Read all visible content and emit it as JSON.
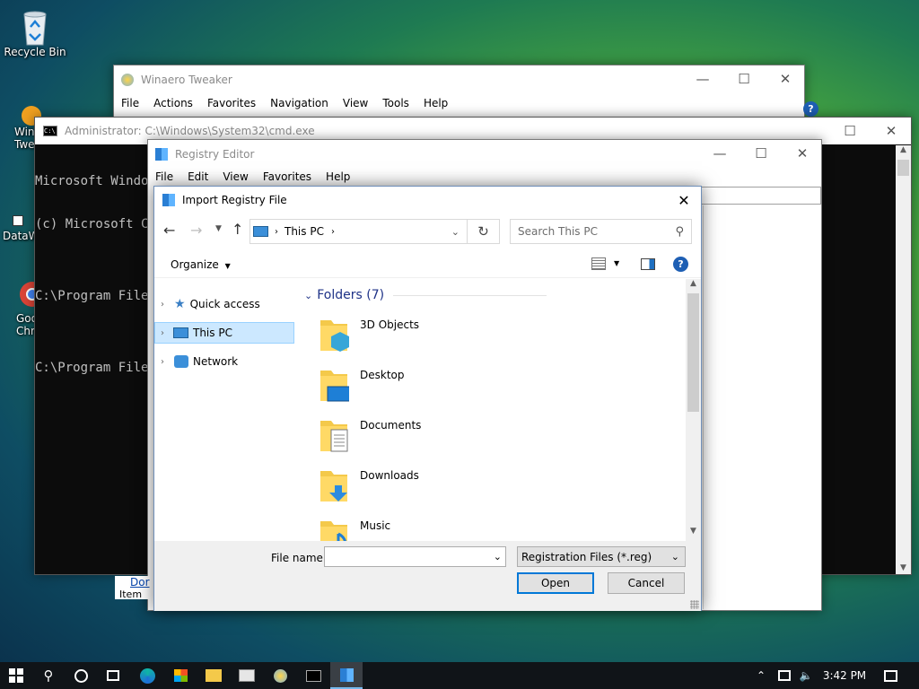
{
  "desktop": {
    "icons": [
      {
        "label": "Recycle Bin"
      },
      {
        "label": "Win\nTwe"
      },
      {
        "label": "DataW"
      },
      {
        "label": "Goo\nChro"
      }
    ]
  },
  "winaero": {
    "title": "Winaero Tweaker",
    "menu": [
      "File",
      "Actions",
      "Favorites",
      "Navigation",
      "View",
      "Tools",
      "Help"
    ]
  },
  "cmd": {
    "title": "Administrator: C:\\Windows\\System32\\cmd.exe",
    "lines": [
      "Microsoft Window",
      "(c) Microsoft Co",
      "",
      "C:\\Program Files",
      "",
      "C:\\Program Files"
    ]
  },
  "regedit": {
    "title": "Registry Editor",
    "menu": [
      "File",
      "Edit",
      "View",
      "Favorites",
      "Help"
    ]
  },
  "behind_footer": {
    "link": "Dor",
    "text": "Item"
  },
  "dialog": {
    "title": "Import Registry File",
    "address": {
      "segments": [
        "This PC"
      ]
    },
    "search_placeholder": "Search This PC",
    "organize_label": "Organize",
    "tree": [
      {
        "label": "Quick access",
        "selected": false
      },
      {
        "label": "This PC",
        "selected": true
      },
      {
        "label": "Network",
        "selected": false
      }
    ],
    "group_header": "Folders (7)",
    "folders": [
      {
        "label": "3D Objects"
      },
      {
        "label": "Desktop"
      },
      {
        "label": "Documents"
      },
      {
        "label": "Downloads"
      },
      {
        "label": "Music"
      }
    ],
    "filename_label": "File name:",
    "filename_value": "",
    "filetype_value": "Registration Files (*.reg)",
    "open_label": "Open",
    "cancel_label": "Cancel"
  },
  "taskbar": {
    "clock": "3:42 PM",
    "accent": "#0078d7"
  }
}
